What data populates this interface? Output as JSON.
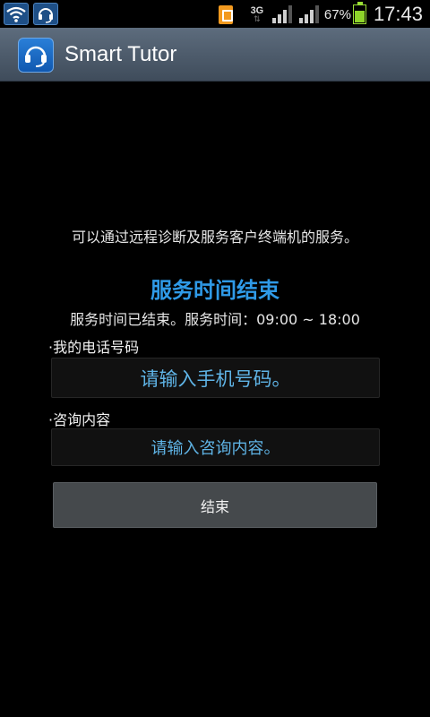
{
  "status_bar": {
    "network": "3G",
    "battery": "67%",
    "battery_level": 0.67,
    "time": "17:43",
    "icons": [
      "wifi-icon",
      "headset-icon",
      "sim-icon",
      "signal-icon",
      "battery-icon"
    ]
  },
  "app_bar": {
    "title": "Smart Tutor",
    "icon": "headset-icon"
  },
  "main": {
    "description": "可以通过远程诊断及服务客户终端机的服务。",
    "service_title": "服务时间结束",
    "service_time": "服务时间已结束。服务时间：09:00 ~ 18:00",
    "phone_label": "·我的电话号码",
    "phone_placeholder": "请输入手机号码。",
    "inquiry_label": "·咨询内容",
    "inquiry_placeholder": "请输入咨询内容。",
    "end_button": "结束"
  },
  "colors": {
    "accent": "#2f9ae7",
    "placeholder": "#5fb4e6",
    "action_bar": "#4e5c6c",
    "battery": "#8ed42a"
  }
}
